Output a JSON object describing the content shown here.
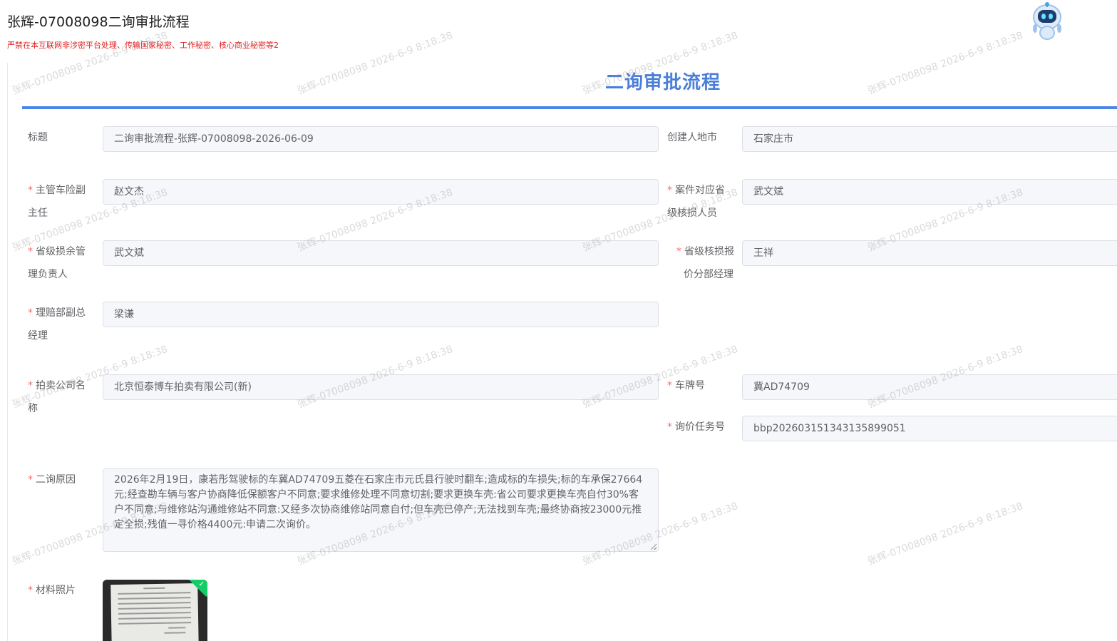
{
  "header": {
    "title": "张辉-07008098二询审批流程",
    "warning": "严禁在本互联网非涉密平台处理、传输国家秘密、工作秘密、核心商业秘密等2"
  },
  "form": {
    "title": "二询审批流程",
    "fields": {
      "title": {
        "label": "标题",
        "value": "二询审批流程-张辉-07008098-2026-06-09"
      },
      "creator_city": {
        "label": "创建人地市",
        "value": "石家庄市"
      },
      "vehicle_vp": {
        "label_line1": "主管车险副",
        "label_line2": "主任",
        "value": "赵文杰"
      },
      "case_reviewer": {
        "label_line1": "案件对应省",
        "label_line2": "级核损人员",
        "value": "武文斌"
      },
      "salvage_manager": {
        "label_line1": "省级损余管",
        "label_line2": "理负责人",
        "value": "武文斌"
      },
      "quote_manager": {
        "label_line1": "省级核损报",
        "label_line2": "价分部经理",
        "value": "王祥"
      },
      "claims_vgm": {
        "label_line1": "理赔部副总",
        "label_line2": "经理",
        "value": "梁谦"
      },
      "auction_company": {
        "label_line1": "拍卖公司名",
        "label_line2": "称",
        "value": "北京恒泰博车拍卖有限公司(新)"
      },
      "plate_number": {
        "label": "车牌号",
        "value": "冀AD74709"
      },
      "inquiry_task_no": {
        "label": "询价任务号",
        "value": "bbp202603151343135899051"
      },
      "reason": {
        "label": "二询原因",
        "value": "2026年2月19日，康若彤驾驶标的车冀AD74709五菱在石家庄市元氏县行驶时翻车;造成标的车损失;标的车承保27664元;经查勘车辆与客户协商降低保额客户不同意;要求维修处理不同意切割;要求更换车壳:省公司要求更换车壳自付30%客户不同意;与维修站沟通维修站不同意:又经多次协商维修站同意自付;但车壳已停产;无法找到车壳;最终协商按23000元推定全损;残值一寻价格4400元:申请二次询价。"
      },
      "photos": {
        "label": "材料照片"
      }
    },
    "required_mark": "*"
  },
  "watermark": "张辉-07008098  2026-6-9 8:18:38",
  "icons": {
    "assistant": "robot-assistant-icon",
    "uploaded": "check-icon"
  },
  "colors": {
    "accent": "#4a86e8",
    "required": "#f56c6c",
    "warning": "#e02020"
  }
}
